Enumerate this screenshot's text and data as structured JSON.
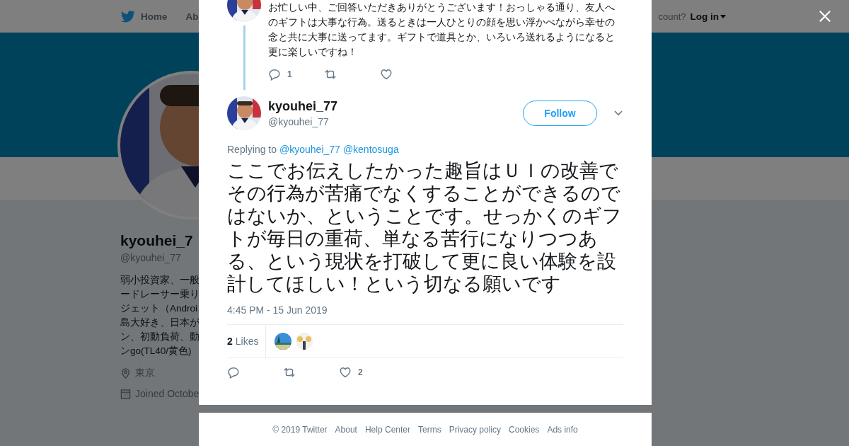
{
  "page": {
    "nav": {
      "home": "Home",
      "about": "Ab",
      "account_prompt": "count?",
      "login": "Log in"
    },
    "profile": {
      "name": "kyouhei_7",
      "handle": "@kyouhei_77",
      "bio_lines": [
        "弱小投資家、一般",
        "ードレーサー乗り",
        "ジェット（Androi",
        "島大好き、日本が",
        "ン、初動負荷、動",
        "ンgo(TL40/黄色)"
      ],
      "location": "東京",
      "joined": "Joined Octobe"
    }
  },
  "modal": {
    "previous_tweet": {
      "text": "お忙しい中、ご回答いただきありがとうございます！おっしゃる通り、友人へのギフトは大事な行為。送るときは一人ひとりの顔を思い浮かべながら幸せの念と共に大事に送ってます。ギフトで道具とか、いろいろ送れるようになると更に楽しいですね！",
      "reply_count": "1"
    },
    "tweet": {
      "name": "kyouhei_77",
      "handle": "@kyouhei_77",
      "follow_label": "Follow",
      "replying_label": "Replying to",
      "mentions": [
        "@kyouhei_77",
        "@kentosuga"
      ],
      "text": "ここでお伝えしたかった趣旨はＵＩの改善でその行為が苦痛でなくすることができるのではないか、ということです。せっかくのギフトが毎日の重荷、単なる苦行になりつつある、という現状を打破して更に良い体験を設計してほしい！という切なる願いです",
      "timestamp": "4:45 PM - 15 Jun 2019",
      "likes_count": "2",
      "likes_label": "Likes",
      "like_count": "2"
    }
  },
  "footer": {
    "links": [
      "© 2019 Twitter",
      "About",
      "Help Center",
      "Terms",
      "Privacy policy",
      "Cookies",
      "Ads info"
    ]
  }
}
